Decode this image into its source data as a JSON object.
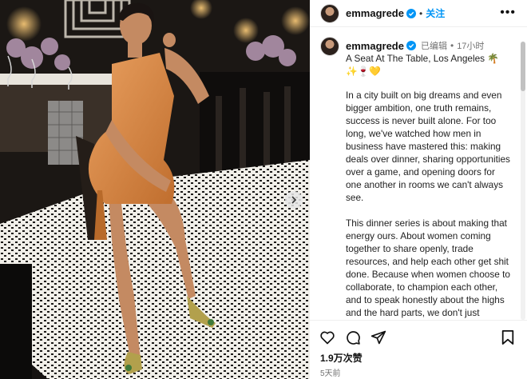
{
  "user": {
    "username": "emmagrede",
    "follow_label": "关注",
    "separator": "•",
    "more_label": "•••"
  },
  "caption": {
    "edited_label": "已编辑",
    "time_ago": "17小时",
    "title": "A Seat At The Table, Los Angeles 🌴 ✨🍷💛",
    "paragraphs": [
      "In a city built on big dreams and even bigger ambition, one truth remains, success is never built alone. For too long, we've watched how men in business have mastered this: making deals over dinner, sharing opportunities over a game, and opening doors for one another in rooms we can't always see.",
      "This dinner series is about making that energy ours. About women coming together to share openly, trade resources, and help each other get shit done. Because when women choose to collaborate, to champion each other, and to speak honestly about the highs and the hard parts, we don't just change our own stories. We change what's possible for every"
    ]
  },
  "footer": {
    "likes": "1.9万次赞",
    "date": "5天前"
  },
  "icons": [
    "verified-badge-icon",
    "heart-icon",
    "comment-icon",
    "share-icon",
    "bookmark-icon",
    "chevron-right-icon"
  ],
  "colors": {
    "accent": "#0095f6",
    "dress": "#d98a45"
  }
}
